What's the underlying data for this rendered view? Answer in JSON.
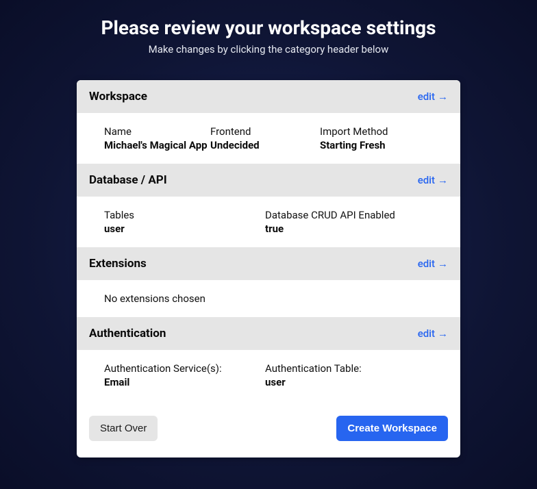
{
  "header": {
    "title": "Please review your workspace settings",
    "subtitle": "Make changes by clicking the category header below"
  },
  "editLabel": "edit",
  "sections": {
    "workspace": {
      "title": "Workspace",
      "fields": {
        "name": {
          "label": "Name",
          "value": "Michael's Magical App"
        },
        "frontend": {
          "label": "Frontend",
          "value": "Undecided"
        },
        "importMethod": {
          "label": "Import Method",
          "value": "Starting Fresh"
        }
      }
    },
    "database": {
      "title": "Database / API",
      "fields": {
        "tables": {
          "label": "Tables",
          "value": "user"
        },
        "crud": {
          "label": "Database CRUD API Enabled",
          "value": "true"
        }
      }
    },
    "extensions": {
      "title": "Extensions",
      "empty": "No extensions chosen"
    },
    "auth": {
      "title": "Authentication",
      "fields": {
        "services": {
          "label": "Authentication Service(s):",
          "value": "Email"
        },
        "table": {
          "label": "Authentication Table:",
          "value": "user"
        }
      }
    }
  },
  "footer": {
    "startOver": "Start Over",
    "create": "Create Workspace"
  }
}
